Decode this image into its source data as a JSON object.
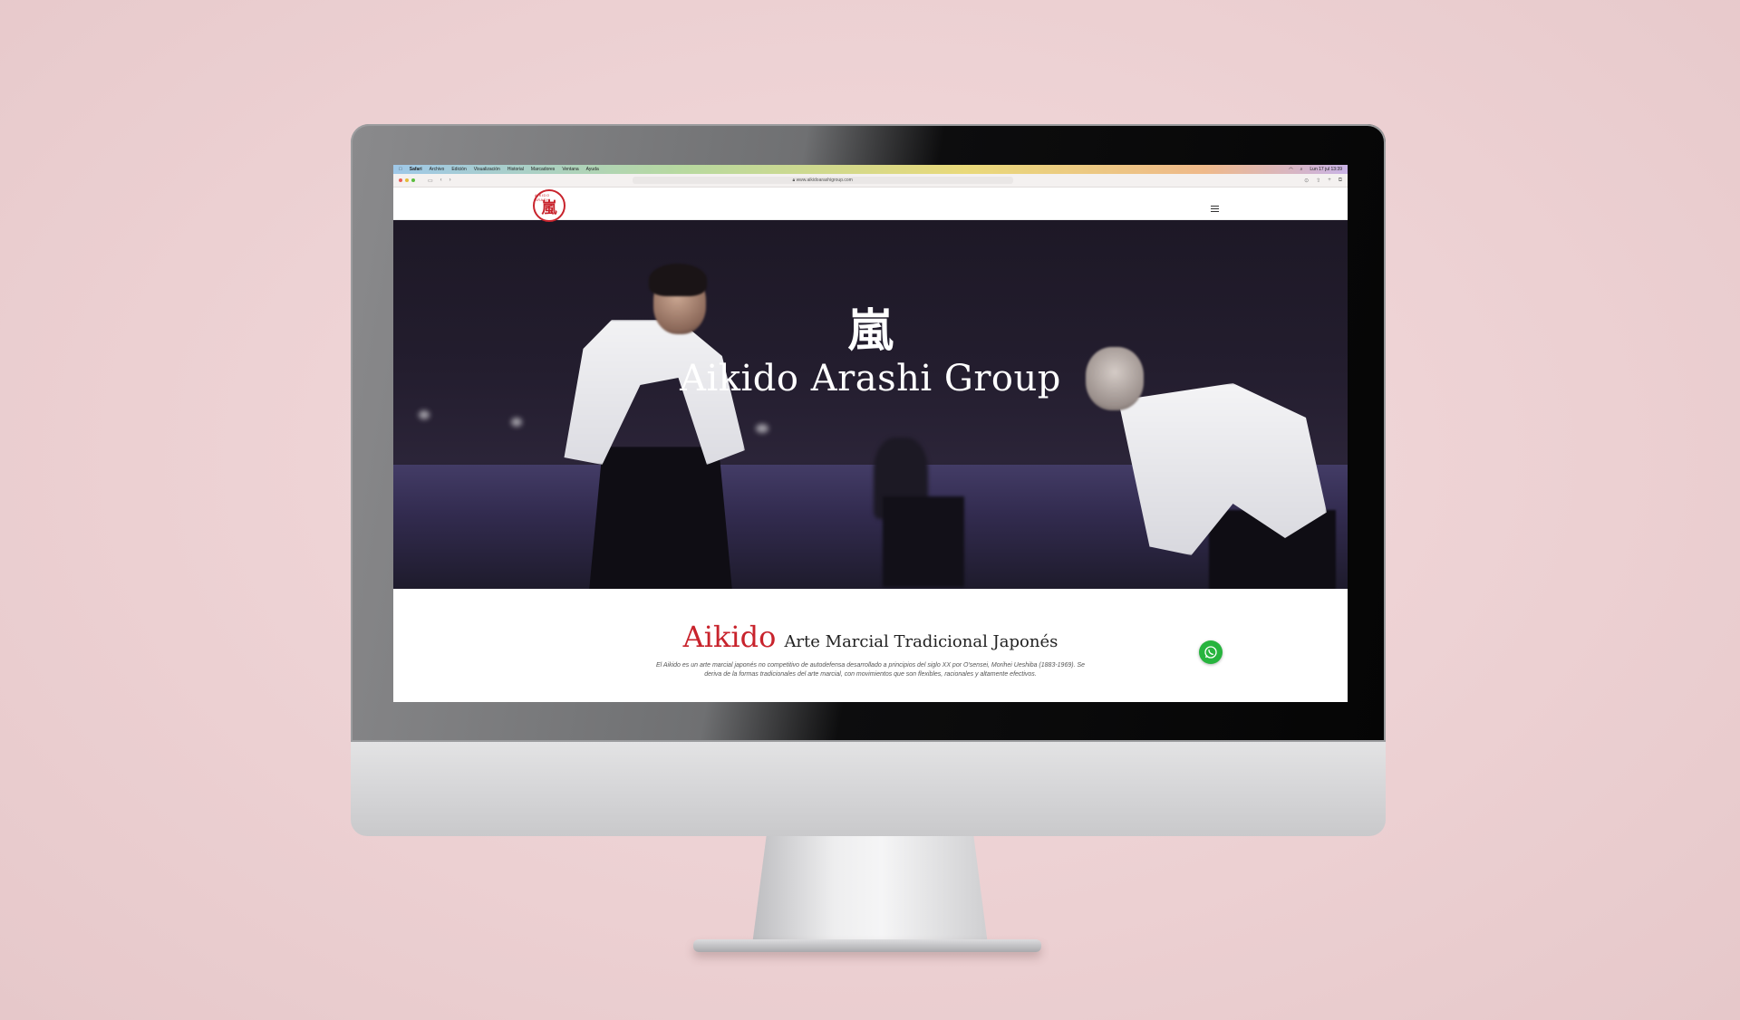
{
  "menubar": {
    "app": "Safari",
    "items": [
      "Archivo",
      "Edición",
      "Visualización",
      "Historial",
      "Marcadores",
      "Ventana",
      "Ayuda"
    ],
    "clock": "Lun 17 jul 13:39"
  },
  "browser": {
    "url": "www.aikidoarashigroup.com"
  },
  "site": {
    "logo_kanji": "嵐",
    "logo_ring_text": "AIKIDO ARASHI"
  },
  "hero": {
    "kanji": "嵐",
    "title": "Aikido Arashi Group"
  },
  "intro": {
    "heading_accent": "Aikido",
    "heading_rest": "Arte Marcial Tradicional Japonés",
    "text": "El Aikido es un arte marcial japonés no competitivo de autodefensa desarrollado a principios del siglo XX por O'sensei, Morihei Ueshiba (1883-1969). Se deriva de la formas tradicionales del arte marcial, con movimientos que son flexibles, racionales y altamente efectivos."
  },
  "colors": {
    "accent": "#c8232c",
    "whatsapp": "#27b43e",
    "background": "#efd4d6"
  },
  "icons": {
    "whatsapp": "whatsapp-icon",
    "menu": "hamburger-icon"
  }
}
